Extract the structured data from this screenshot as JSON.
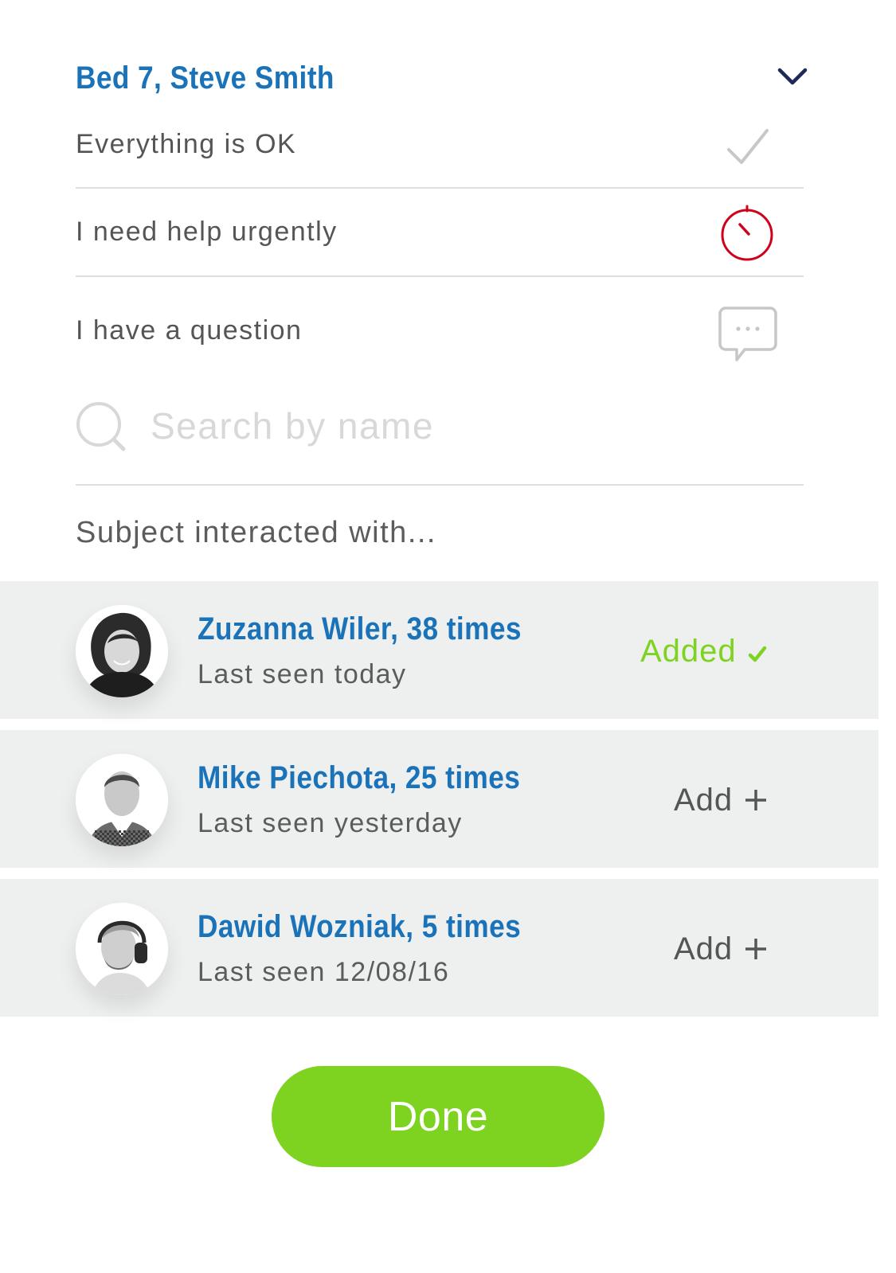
{
  "header": {
    "title": "Bed 7, Steve Smith",
    "toggle_icon": "chevron-down-icon"
  },
  "status_options": [
    {
      "label": "Everything is OK",
      "icon": "check-icon",
      "color": "#c7c7c7"
    },
    {
      "label": "I need help urgently",
      "icon": "stopwatch-icon",
      "color": "#d0021b"
    },
    {
      "label": "I have a question",
      "icon": "speech-bubble-icon",
      "color": "#c7c7c7"
    }
  ],
  "search": {
    "placeholder": "Search by name",
    "value": "",
    "icon": "search-icon"
  },
  "subject_label": "Subject interacted with...",
  "people": [
    {
      "name": "Zuzanna Wiler, 38 times",
      "last_seen": "Last seen today",
      "action_label": "Added",
      "action_state": "added",
      "action_icon": "check-icon"
    },
    {
      "name": "Mike Piechota, 25 times",
      "last_seen": "Last seen yesterday",
      "action_label": "Add",
      "action_state": "add",
      "action_icon": "plus-icon"
    },
    {
      "name": "Dawid Wozniak, 5 times",
      "last_seen": "Last seen 12/08/16",
      "action_label": "Add",
      "action_state": "add",
      "action_icon": "plus-icon"
    }
  ],
  "done_button": {
    "label": "Done"
  },
  "colors": {
    "accent_blue": "#1a73b9",
    "accent_green": "#7ed321",
    "alert_red": "#d0021b",
    "row_background": "#eeefef"
  }
}
